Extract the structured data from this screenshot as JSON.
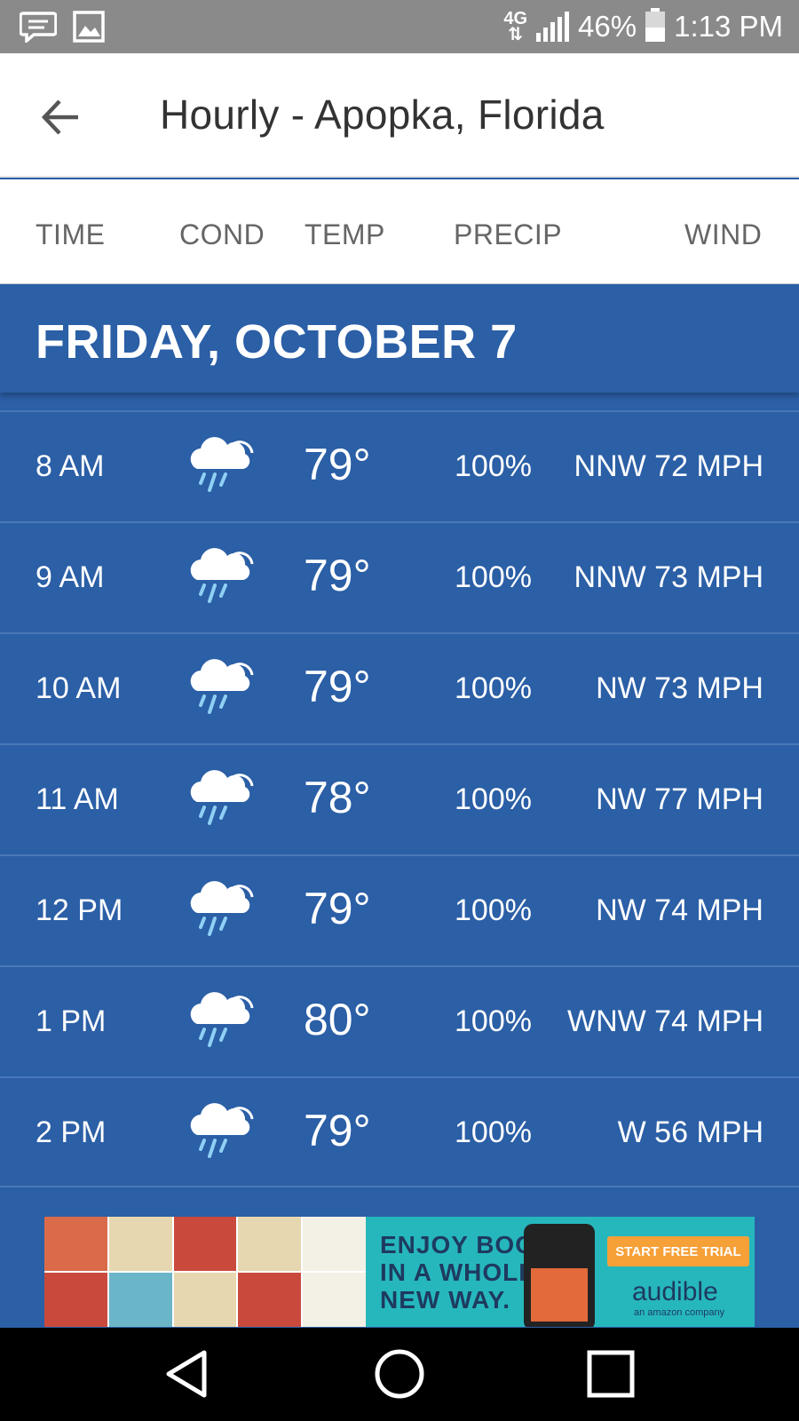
{
  "status_bar": {
    "network": "4G",
    "battery": "46%",
    "battery_level": 0.46,
    "time": "1:13 PM",
    "icons": [
      "chat-icon",
      "image-icon"
    ]
  },
  "header": {
    "title": "Hourly - Apopka, Florida",
    "back_icon": "arrow-left-icon"
  },
  "columns": {
    "time": "TIME",
    "cond": "COND",
    "temp": "TEMP",
    "precip": "PRECIP",
    "wind": "WIND"
  },
  "day": {
    "label": "FRIDAY, OCTOBER 7"
  },
  "hours": [
    {
      "time": "8 AM",
      "cond_icon": "rain-cloud-icon",
      "temp": "79°",
      "precip": "100%",
      "wind": "NNW 72 MPH"
    },
    {
      "time": "9 AM",
      "cond_icon": "rain-cloud-icon",
      "temp": "79°",
      "precip": "100%",
      "wind": "NNW 73 MPH"
    },
    {
      "time": "10 AM",
      "cond_icon": "rain-cloud-icon",
      "temp": "79°",
      "precip": "100%",
      "wind": "NW 73 MPH"
    },
    {
      "time": "11 AM",
      "cond_icon": "rain-cloud-icon",
      "temp": "78°",
      "precip": "100%",
      "wind": "NW 77 MPH"
    },
    {
      "time": "12 PM",
      "cond_icon": "rain-cloud-icon",
      "temp": "79°",
      "precip": "100%",
      "wind": "NW 74 MPH"
    },
    {
      "time": "1 PM",
      "cond_icon": "rain-cloud-icon",
      "temp": "80°",
      "precip": "100%",
      "wind": "WNW 74 MPH"
    },
    {
      "time": "2 PM",
      "cond_icon": "rain-cloud-icon",
      "temp": "79°",
      "precip": "100%",
      "wind": "W 56 MPH"
    }
  ],
  "ad": {
    "headline_1": "ENJOY BOOKS",
    "headline_2": "IN A WHOLE",
    "headline_3": "NEW WAY.",
    "cta": "START FREE TRIAL",
    "brand": "audible",
    "brand_sub": "an amazon company"
  },
  "nav": {
    "back_icon": "triangle-back-icon",
    "home_icon": "circle-home-icon",
    "recents_icon": "square-recents-icon"
  },
  "colors": {
    "primary_blue": "#2b5fa6",
    "row_divider": "#4a78b8",
    "rain_drop": "#8fd0f5",
    "ad_teal": "#26b7bd",
    "ad_orange": "#f6a038"
  }
}
